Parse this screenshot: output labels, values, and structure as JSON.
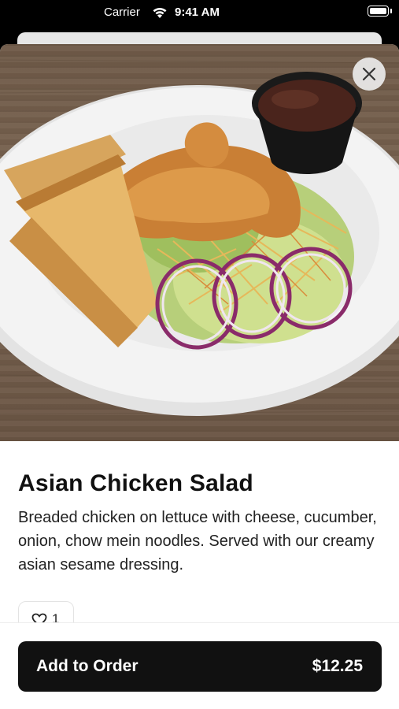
{
  "status_bar": {
    "carrier": "Carrier",
    "time": "9:41 AM",
    "icons": [
      "wifi-icon",
      "battery-icon"
    ]
  },
  "item": {
    "image_alt": "salad-photo",
    "title": "Asian Chicken Salad",
    "description": "Breaded chicken on lettuce with cheese, cucumber, onion, chow mein noodles. Served with our creamy asian sesame dressing.",
    "likes": "1"
  },
  "actions": {
    "close_icon": "close-icon",
    "like_icon": "heart-icon",
    "add_label": "Add to Order",
    "price": "$12.25"
  },
  "colors": {
    "button_background": "#111111",
    "button_text": "#ffffff",
    "table_wood": "#6f5a48",
    "plate": "#f2f2f2"
  }
}
